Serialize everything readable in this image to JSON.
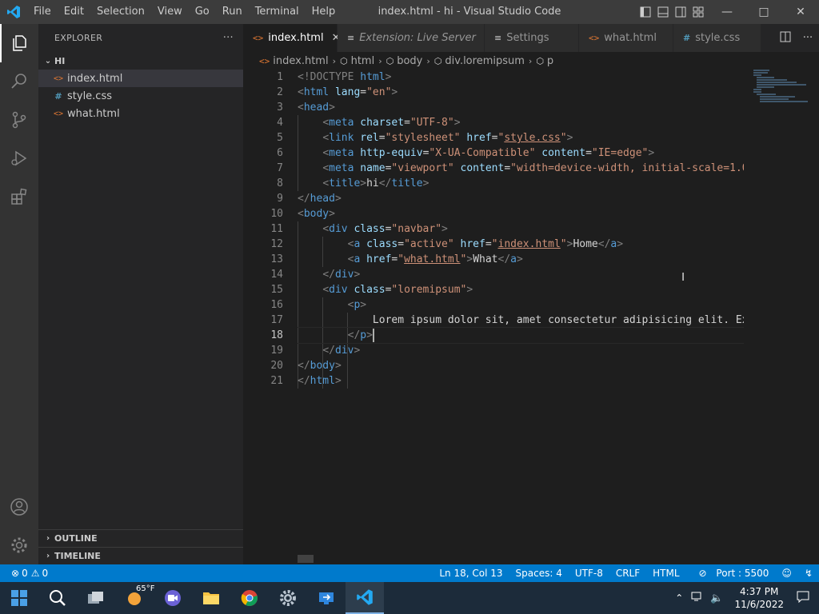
{
  "window": {
    "title": "index.html - hi - Visual Studio Code",
    "menu": [
      "File",
      "Edit",
      "Selection",
      "View",
      "Go",
      "Run",
      "Terminal",
      "Help"
    ]
  },
  "sidebar": {
    "header": "EXPLORER",
    "more": "···",
    "folder": "HI",
    "files": [
      {
        "name": "index.html",
        "icon": "<>",
        "type": "html"
      },
      {
        "name": "style.css",
        "icon": "#",
        "type": "css"
      },
      {
        "name": "what.html",
        "icon": "<>",
        "type": "html"
      }
    ],
    "outline": "OUTLINE",
    "timeline": "TIMELINE"
  },
  "tabs": [
    {
      "label": "index.html",
      "icon": "<>",
      "active": true
    },
    {
      "label": "Extension: Live Server",
      "icon": "≡",
      "active": false
    },
    {
      "label": "Settings",
      "icon": "≡",
      "active": false
    },
    {
      "label": "what.html",
      "icon": "<>",
      "active": false
    },
    {
      "label": "style.css",
      "icon": "#",
      "active": false
    }
  ],
  "breadcrumbs": [
    "index.html",
    "html",
    "body",
    "div.loremipsum",
    "p"
  ],
  "editor": {
    "line_numbers": [
      "1",
      "2",
      "3",
      "4",
      "5",
      "6",
      "7",
      "8",
      "9",
      "10",
      "11",
      "12",
      "13",
      "14",
      "15",
      "16",
      "17",
      "18",
      "19",
      "20",
      "21"
    ],
    "current_line": 18
  },
  "statusbar": {
    "errors": "0",
    "warnings": "0",
    "position": "Ln 18, Col 13",
    "spaces": "Spaces: 4",
    "encoding": "UTF-8",
    "eol": "CRLF",
    "language": "HTML",
    "port": "Port : 5500"
  },
  "taskbar": {
    "weather_temp": "65°F",
    "time": "4:37 PM",
    "date": "11/6/2022"
  },
  "colors": {
    "accent": "#007acc",
    "titlebar": "#3c3c3c",
    "editor_bg": "#1e1e1e"
  }
}
